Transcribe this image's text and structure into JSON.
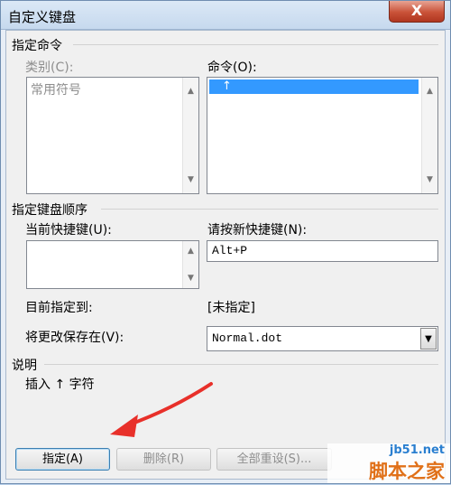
{
  "window": {
    "title": "自定义键盘",
    "close_glyph": "X"
  },
  "specify_command": {
    "group_title": "指定命令",
    "categories_label": "类别(C):",
    "categories": [
      "常用符号"
    ],
    "commands_label": "命令(O):",
    "commands": [
      "↑"
    ]
  },
  "key_sequence": {
    "group_title": "指定键盘顺序",
    "current_keys_label": "当前快捷键(U):",
    "current_keys": [],
    "new_key_label": "请按新快捷键(N):",
    "new_key_value": "Alt+P"
  },
  "assignment": {
    "currently_assigned_label": "目前指定到:",
    "currently_assigned_value": "[未指定]",
    "save_in_label": "将更改保存在(V):",
    "save_in_value": "Normal.dot"
  },
  "description": {
    "group_title": "说明",
    "text": "插入 ↑ 字符"
  },
  "buttons": {
    "assign": "指定(A)",
    "remove": "删除(R)",
    "reset_all": "全部重设(S)..."
  },
  "watermark": {
    "url": "jb51.net",
    "brand": "脚本之家"
  },
  "colors": {
    "arrow": "#e8302a",
    "selection": "#3399ff"
  }
}
